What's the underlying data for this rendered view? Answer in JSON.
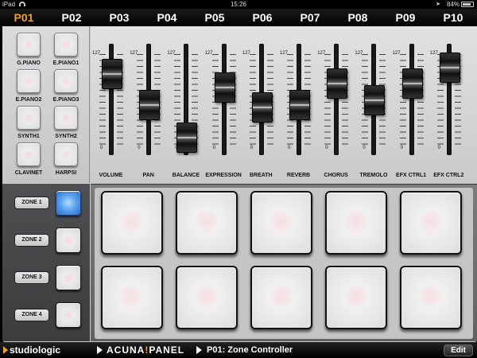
{
  "status_bar": {
    "device": "iPad",
    "time": "15:26",
    "battery": "84%"
  },
  "program_tabs": [
    {
      "label": "P01",
      "active": true
    },
    {
      "label": "P02"
    },
    {
      "label": "P03"
    },
    {
      "label": "P04"
    },
    {
      "label": "P05"
    },
    {
      "label": "P06"
    },
    {
      "label": "P07"
    },
    {
      "label": "P08"
    },
    {
      "label": "P09"
    },
    {
      "label": "P10"
    }
  ],
  "presets": [
    "G.PIANO",
    "E.PIANO1",
    "E.PIANO2",
    "E.PIANO3",
    "SYNTH1",
    "SYNTH2",
    "CLAVINET",
    "HARPSI"
  ],
  "zones": [
    {
      "label": "ZONE 1",
      "active": true
    },
    {
      "label": "ZONE 2",
      "active": false
    },
    {
      "label": "ZONE 3",
      "active": false
    },
    {
      "label": "ZONE 4",
      "active": false
    }
  ],
  "slider_scale": {
    "max": "127",
    "min": "0"
  },
  "sliders": [
    {
      "label": "VOLUME",
      "value": 0.83
    },
    {
      "label": "PAN",
      "value": 0.47
    },
    {
      "label": "BALANCE",
      "value": 0.1
    },
    {
      "label": "EXPRESSION",
      "value": 0.67
    },
    {
      "label": "BREATH",
      "value": 0.45
    },
    {
      "label": "REVERB",
      "value": 0.47
    },
    {
      "label": "CHORUS",
      "value": 0.72
    },
    {
      "label": "TREMOLO",
      "value": 0.53
    },
    {
      "label": "EFX CTRL1",
      "value": 0.72
    },
    {
      "label": "EFX CTRL2",
      "value": 0.9
    }
  ],
  "pads": {
    "rows": 2,
    "cols": 5
  },
  "bottom_bar": {
    "brand": "studiologic",
    "app_name_prefix": "ACUNA",
    "app_name_suffix": "PANEL",
    "program": "P01:  Zone Controller",
    "edit_label": "Edit"
  }
}
